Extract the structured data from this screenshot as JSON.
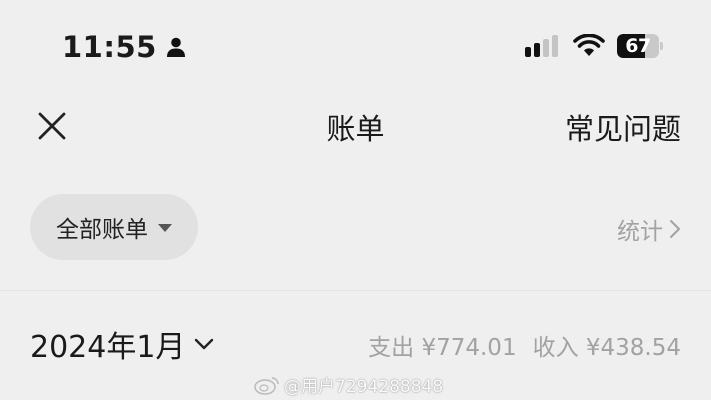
{
  "status_bar": {
    "time": "11:55",
    "battery_level": "67",
    "battery_fraction": 0.67
  },
  "nav": {
    "title": "账单",
    "faq_label": "常见问题",
    "close_icon": "close-icon"
  },
  "filter": {
    "selected": "全部账单",
    "stats_label": "统计"
  },
  "month": {
    "label": "2024年1月",
    "expense": "支出 ¥774.01",
    "income": "收入 ¥438.54"
  },
  "watermark": {
    "text": "@用户7294288848"
  },
  "colors": {
    "background": "#efefef",
    "pill": "#e1e1e1",
    "muted_text": "#a2a2a2"
  }
}
